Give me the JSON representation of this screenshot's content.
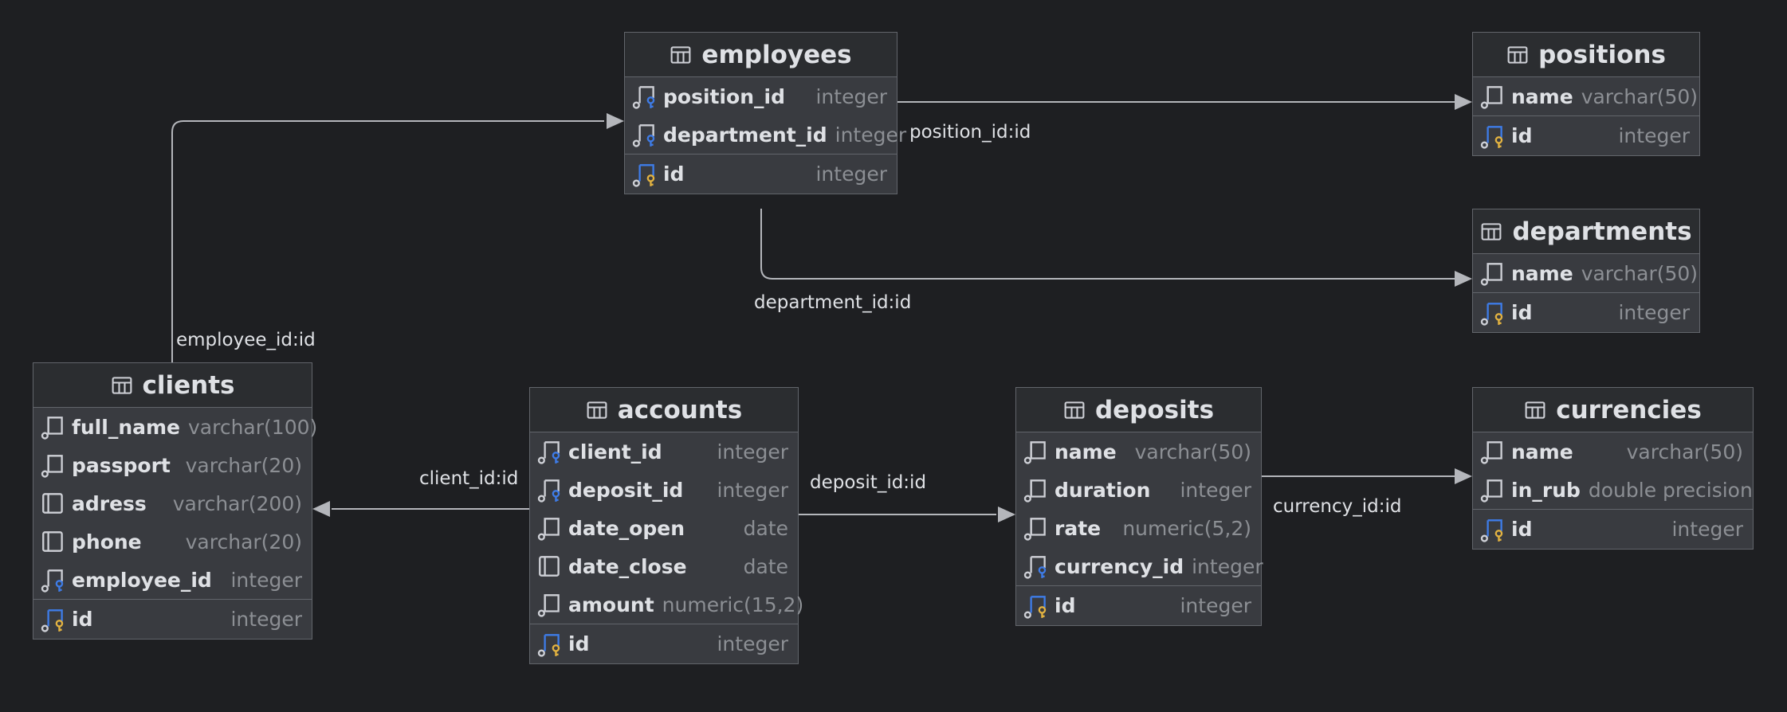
{
  "colors": {
    "background": "#1e1f22",
    "table_body": "#393b40",
    "table_header": "#2b2d30",
    "border": "#62656b",
    "edge": "#b4b6bb",
    "fk_accent": "#3e7ce8",
    "pk_accent": "#e3b341"
  },
  "tables": {
    "employees": {
      "name": "employees",
      "icon": "table-icon",
      "columns": [
        {
          "name": "position_id",
          "type": "integer",
          "icon": "foreign-key-column-icon"
        },
        {
          "name": "department_id",
          "type": "integer",
          "icon": "foreign-key-column-icon"
        },
        {
          "name": "id",
          "type": "integer",
          "icon": "primary-key-column-icon"
        }
      ]
    },
    "positions": {
      "name": "positions",
      "icon": "table-icon",
      "columns": [
        {
          "name": "name",
          "type": "varchar(50)",
          "icon": "required-column-icon"
        },
        {
          "name": "id",
          "type": "integer",
          "icon": "primary-key-column-icon"
        }
      ]
    },
    "departments": {
      "name": "departments",
      "icon": "table-icon",
      "columns": [
        {
          "name": "name",
          "type": "varchar(50)",
          "icon": "required-column-icon"
        },
        {
          "name": "id",
          "type": "integer",
          "icon": "primary-key-column-icon"
        }
      ]
    },
    "clients": {
      "name": "clients",
      "icon": "table-icon",
      "columns": [
        {
          "name": "full_name",
          "type": "varchar(100)",
          "icon": "required-column-icon"
        },
        {
          "name": "passport",
          "type": "varchar(20)",
          "icon": "required-column-icon"
        },
        {
          "name": "adress",
          "type": "varchar(200)",
          "icon": "column-icon"
        },
        {
          "name": "phone",
          "type": "varchar(20)",
          "icon": "column-icon"
        },
        {
          "name": "employee_id",
          "type": "integer",
          "icon": "foreign-key-column-icon"
        },
        {
          "name": "id",
          "type": "integer",
          "icon": "primary-key-column-icon"
        }
      ]
    },
    "accounts": {
      "name": "accounts",
      "icon": "table-icon",
      "columns": [
        {
          "name": "client_id",
          "type": "integer",
          "icon": "foreign-key-column-icon"
        },
        {
          "name": "deposit_id",
          "type": "integer",
          "icon": "foreign-key-column-icon"
        },
        {
          "name": "date_open",
          "type": "date",
          "icon": "required-column-icon"
        },
        {
          "name": "date_close",
          "type": "date",
          "icon": "column-icon"
        },
        {
          "name": "amount",
          "type": "numeric(15,2)",
          "icon": "required-column-icon"
        },
        {
          "name": "id",
          "type": "integer",
          "icon": "primary-key-column-icon"
        }
      ]
    },
    "deposits": {
      "name": "deposits",
      "icon": "table-icon",
      "columns": [
        {
          "name": "name",
          "type": "varchar(50)",
          "icon": "required-column-icon"
        },
        {
          "name": "duration",
          "type": "integer",
          "icon": "required-column-icon"
        },
        {
          "name": "rate",
          "type": "numeric(5,2)",
          "icon": "required-column-icon"
        },
        {
          "name": "currency_id",
          "type": "integer",
          "icon": "foreign-key-column-icon"
        },
        {
          "name": "id",
          "type": "integer",
          "icon": "primary-key-column-icon"
        }
      ]
    },
    "currencies": {
      "name": "currencies",
      "icon": "table-icon",
      "columns": [
        {
          "name": "name",
          "type": "varchar(50)",
          "icon": "required-column-icon"
        },
        {
          "name": "in_rub",
          "type": "double precision",
          "icon": "required-column-icon"
        },
        {
          "name": "id",
          "type": "integer",
          "icon": "primary-key-column-icon"
        }
      ]
    }
  },
  "relations": {
    "position": "position_id:id",
    "department": "department_id:id",
    "employee": "employee_id:id",
    "client": "client_id:id",
    "deposit": "deposit_id:id",
    "currency": "currency_id:id"
  }
}
